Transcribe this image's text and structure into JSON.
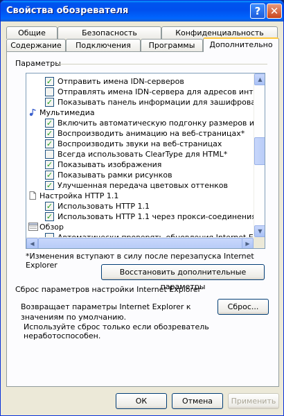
{
  "window": {
    "title": "Свойства обозревателя"
  },
  "titlebar": {
    "help_glyph": "?",
    "close_glyph": "✕"
  },
  "tabs": [
    {
      "label": "Общие"
    },
    {
      "label": "Безопасность"
    },
    {
      "label": "Конфиденциальность"
    },
    {
      "label": "Содержание"
    },
    {
      "label": "Подключения"
    },
    {
      "label": "Программы"
    },
    {
      "label": "Дополнительно"
    }
  ],
  "settings": {
    "group_label": "Параметры",
    "items": [
      {
        "type": "checkbox",
        "checked": true,
        "label": "Отправить имена IDN-серверов"
      },
      {
        "type": "checkbox",
        "checked": false,
        "label": "Отправлять имена IDN-сервера для адресов интрасети"
      },
      {
        "type": "checkbox",
        "checked": true,
        "label": "Показывать панель информации для зашифрованных а"
      },
      {
        "type": "category",
        "icon": "multimedia-icon",
        "label": "Мультимедиа"
      },
      {
        "type": "checkbox",
        "checked": true,
        "label": "Включить автоматическую подгонку размеров изображ"
      },
      {
        "type": "checkbox",
        "checked": true,
        "label": "Воспроизводить анимацию на веб-страницах*"
      },
      {
        "type": "checkbox",
        "checked": true,
        "label": "Воспроизводить звуки на веб-страницах"
      },
      {
        "type": "checkbox",
        "checked": false,
        "label": "Всегда использовать ClearType для HTML*"
      },
      {
        "type": "checkbox",
        "checked": true,
        "label": "Показывать изображения"
      },
      {
        "type": "checkbox",
        "checked": true,
        "label": "Показывать рамки рисунков"
      },
      {
        "type": "checkbox",
        "checked": true,
        "label": "Улучшенная передача цветовых оттенков"
      },
      {
        "type": "category",
        "icon": "document-icon",
        "label": "Настройка HTTP 1.1"
      },
      {
        "type": "checkbox",
        "checked": true,
        "label": "Использовать HTTP 1.1"
      },
      {
        "type": "checkbox",
        "checked": true,
        "label": "Использовать HTTP 1.1 через прокси-соединения"
      },
      {
        "type": "category",
        "icon": "browse-icon",
        "label": "Обзор"
      },
      {
        "type": "checkbox",
        "checked": false,
        "label": "Автоматически проверять обновления Internet Explorer"
      }
    ]
  },
  "restart_note": "*Изменения вступают в силу после перезапуска Internet Explorer",
  "restore_button": "Восстановить дополнительные параметры",
  "reset": {
    "title": "Сброс параметров настройки Internet Explorer",
    "description": "Возвращает параметры Internet Explorer к значениям по умолчанию.",
    "button": "Сброс...",
    "hint": "Используйте сброс только если обозреватель неработоспособен."
  },
  "footer": {
    "ok": "ОК",
    "cancel": "Отмена",
    "apply": "Применить"
  },
  "colors": {
    "titlebar": "#0053ee",
    "dialog_bg": "#ece9d8",
    "active_tab_accent": "#ffc83c",
    "check": "#21a121"
  }
}
